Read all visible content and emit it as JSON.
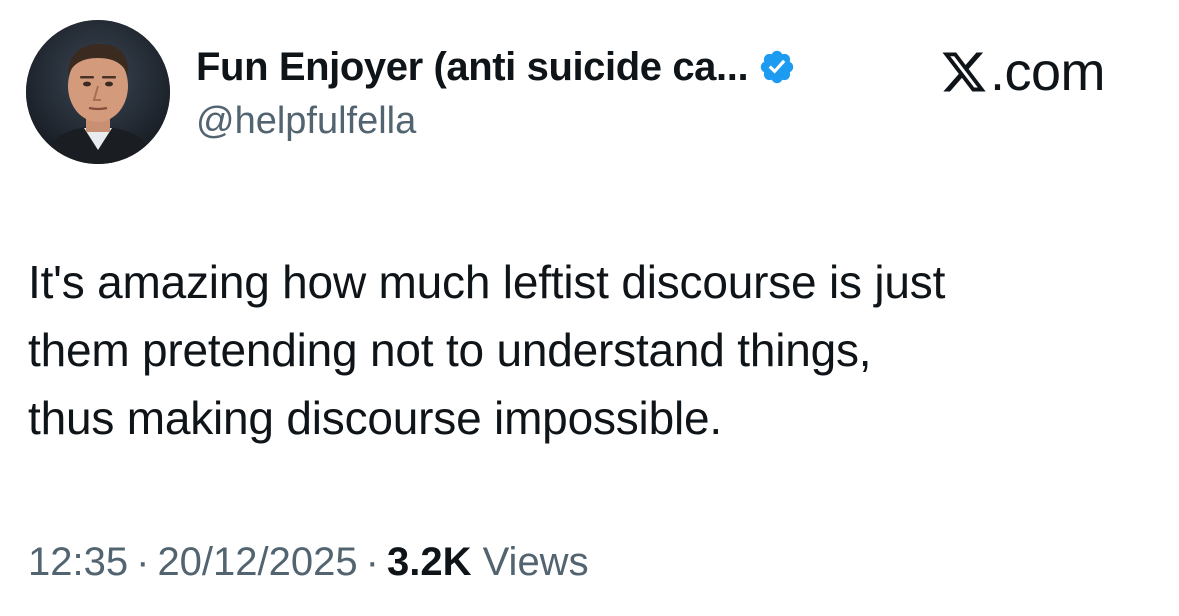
{
  "author": {
    "display_name": "Fun Enjoyer (anti suicide ca...",
    "handle": "@helpfulfella",
    "verified": true,
    "verified_color": "#1d9bf0",
    "avatar_icon": "profile-photo"
  },
  "brand": {
    "label": ".com",
    "icon": "x-logo-icon"
  },
  "tweet": {
    "lines": [
      "It's amazing how much leftist discourse is just",
      "them pretending not to understand things,",
      "thus making discourse impossible."
    ]
  },
  "meta": {
    "time": "12:35",
    "separator": "·",
    "date": "20/12/2025",
    "views_count": "3.2K",
    "views_label": "Views"
  },
  "colors": {
    "text": "#0f1419",
    "secondary": "#536471",
    "background": "#ffffff"
  }
}
